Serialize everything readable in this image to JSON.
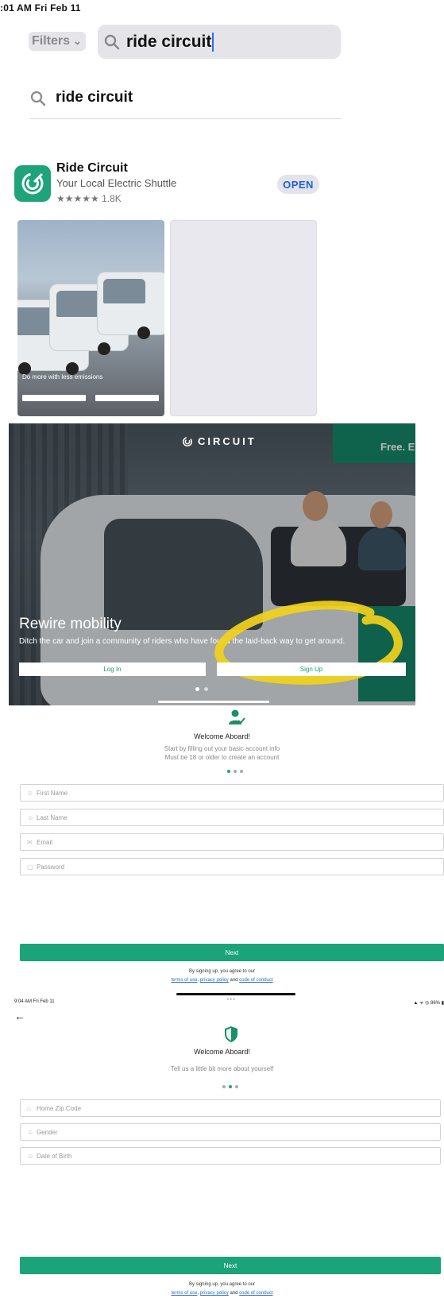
{
  "appstore": {
    "status_time": ":01 AM   Fri Feb 11",
    "filters_label": "Filters",
    "search_value": "ride circuit",
    "suggestion": "ride circuit",
    "app": {
      "name": "Ride Circuit",
      "subtitle": "Your Local Electric Shuttle",
      "rating": "★★★★★ 1.8K",
      "open_label": "OPEN"
    },
    "screenshot_caption": "Do more with less emissions"
  },
  "landing": {
    "logo_text": "CIRCUIT",
    "banner_text": "Free. Ele",
    "title": "Rewire mobility",
    "subtitle": "Ditch the car and join a community of riders who have found the laid-back way to get around.",
    "login_label": "Log In",
    "signup_label": "Sign Up",
    "page_dots_active": 1
  },
  "signup_step1": {
    "title": "Welcome Aboard!",
    "sub1": "Start by filling out your basic account info",
    "sub2": "Must be 18 or older to create an account",
    "fields": {
      "first_name": "First Name",
      "last_name": "Last Name",
      "email": "Email",
      "password": "Password"
    },
    "next_label": "Next",
    "legal_line1": "By signing up, you agree to our",
    "terms": "terms of use",
    "privacy": "privacy policy",
    "and": "and",
    "conduct": "code of conduct"
  },
  "signup_step2": {
    "status_left": "9:04 AM   Fri Feb 11",
    "status_mid": "• • •",
    "status_right": "▲ ᯤ ◎ 86% ▮",
    "back_label": "←",
    "title": "Welcome Aboard!",
    "sub": "Tell us a little bit more about yourself",
    "fields": {
      "zip": "Home Zip Code",
      "gender": "Gender",
      "dob": "Date of Birth"
    },
    "next_label": "Next",
    "legal_line1": "By signing up, you agree to our",
    "terms": "terms of use",
    "privacy": "privacy policy",
    "and": "and",
    "conduct": "code of conduct"
  },
  "colors": {
    "brand_green": "#1ba37a",
    "appstore_blue": "#1d5fd8",
    "highlight_yellow": "#f2d21b"
  }
}
